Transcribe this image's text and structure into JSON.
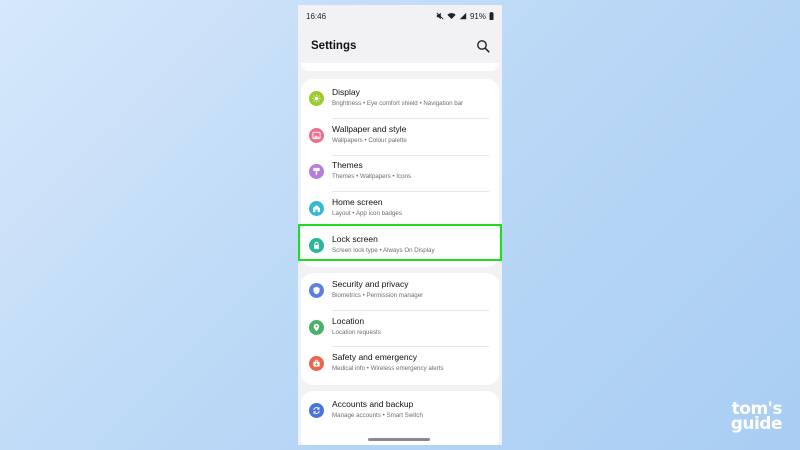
{
  "status_bar": {
    "time": "16:46",
    "battery": "91%",
    "icons": [
      "mute-icon",
      "wifi-icon",
      "signal-icon",
      "battery-icon"
    ]
  },
  "header": {
    "title": "Settings",
    "search_icon": "search-icon"
  },
  "groups": [
    {
      "items": [
        {
          "label": "Display",
          "sub": "Brightness  •  Eye comfort shield  •  Navigation bar",
          "icon": "sun-icon",
          "color": "#9ccc2c"
        },
        {
          "label": "Wallpaper and style",
          "sub": "Wallpapers  •  Colour palette",
          "icon": "image-icon",
          "color": "#ec6f8f"
        },
        {
          "label": "Themes",
          "sub": "Themes  •  Wallpapers  •  Icons",
          "icon": "brush-icon",
          "color": "#b57edc"
        },
        {
          "label": "Home screen",
          "sub": "Layout  •  App icon badges",
          "icon": "home-icon",
          "color": "#35b9d6"
        },
        {
          "label": "Lock screen",
          "sub": "Screen lock type  •  Always On Display",
          "icon": "lock-icon",
          "color": "#2ab59c"
        }
      ]
    },
    {
      "items": [
        {
          "label": "Security and privacy",
          "sub": "Biometrics  •  Permission manager",
          "icon": "shield-icon",
          "color": "#5f7fe0"
        },
        {
          "label": "Location",
          "sub": "Location requests",
          "icon": "location-pin-icon",
          "color": "#4caf6a"
        },
        {
          "label": "Safety and emergency",
          "sub": "Medical info  •  Wireless emergency alerts",
          "icon": "emergency-icon",
          "color": "#e8684f"
        }
      ]
    },
    {
      "items": [
        {
          "label": "Accounts and backup",
          "sub": "Manage accounts  •  Smart Switch",
          "icon": "sync-icon",
          "color": "#4a72e0"
        }
      ]
    }
  ],
  "highlight_color": "#1edc1e",
  "watermark": {
    "line1": "tom's",
    "line2": "guide"
  }
}
